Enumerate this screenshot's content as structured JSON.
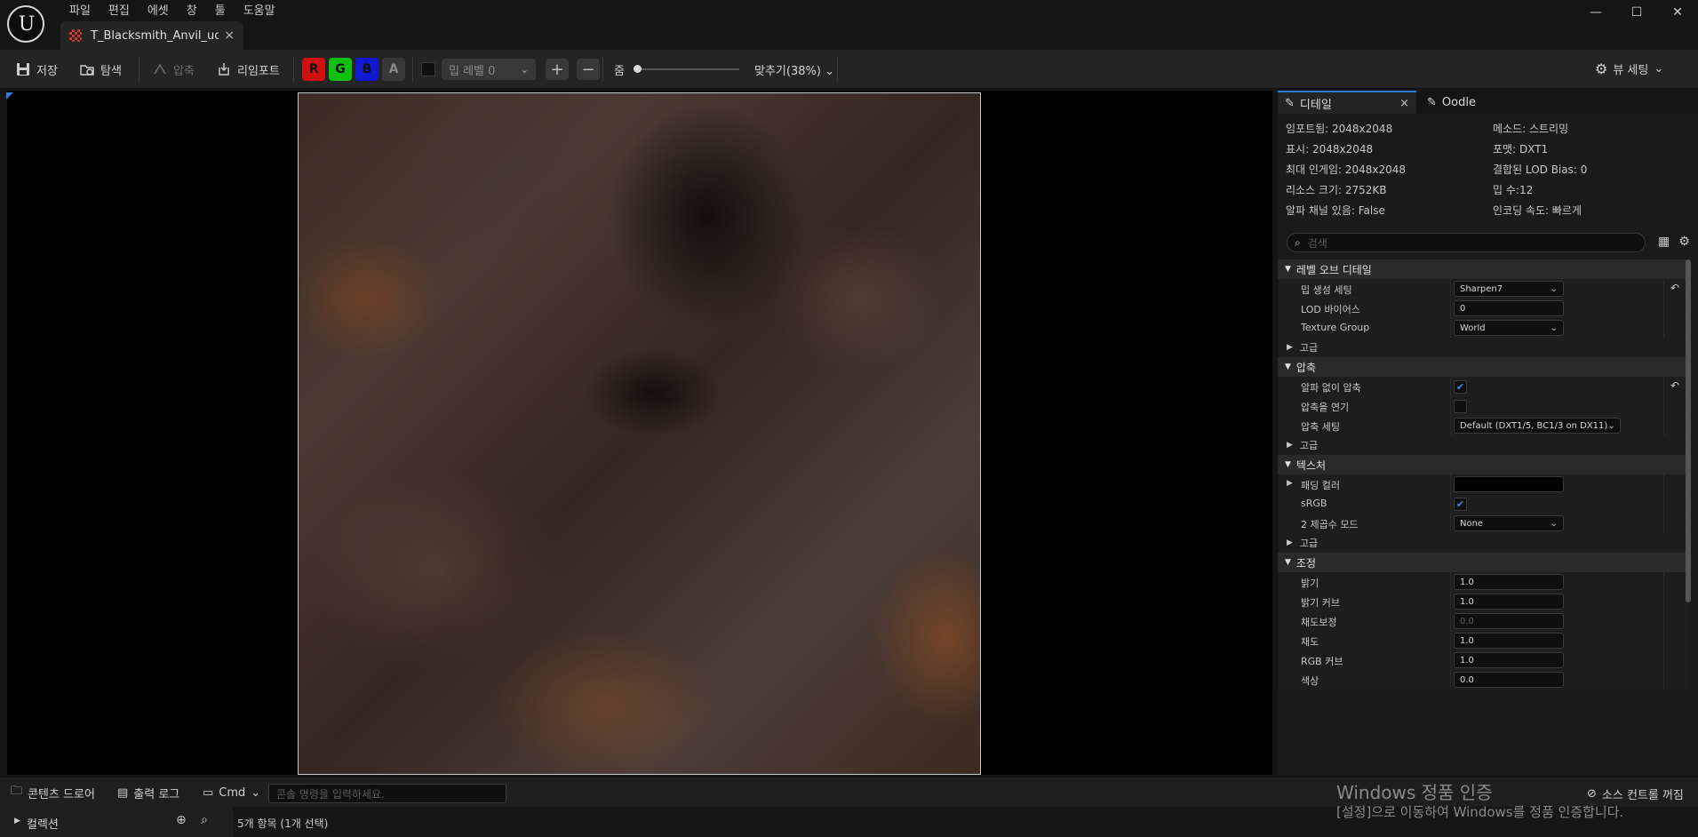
{
  "app": {
    "logo": "ue-logo"
  },
  "menu": [
    "파일",
    "편집",
    "에셋",
    "창",
    "툴",
    "도움말"
  ],
  "window_controls": [
    "—",
    "☐",
    "✕"
  ],
  "document_tab": {
    "label": "T_Blacksmith_Anvil_uck...",
    "close": "×"
  },
  "toolbar": {
    "save": "저장",
    "browse": "탐색",
    "compress": "압축",
    "reimport": "리임포트",
    "channels": [
      "R",
      "G",
      "B",
      "A"
    ],
    "mip_level": "밉 레벨 0",
    "zoom_label": "줌",
    "zoom_fit": "맞추기(38%)",
    "view_settings": "뷰 세팅"
  },
  "details_panel": {
    "tab_details": "디테일",
    "tab_oodle": "Oodle",
    "info": {
      "imported": "임포트됨: 2048x2048",
      "method": "메소드: 스트리밍",
      "displayed": "표시: 2048x2048",
      "format": "포맷: DXT1",
      "max_ingame": "최대 인게임: 2048x2048",
      "combined_lod": "결합된 LOD Bias: 0",
      "resource_size": "리소스 크기: 2752KB",
      "mip_count": "밉 수:12",
      "alpha": "알파 채널 있음: False",
      "encode_speed": "인코딩 속도: 빠르게"
    },
    "search_placeholder": "검색",
    "categories": {
      "lod": "레벨 오브 디테일",
      "compression": "압축",
      "texture": "텍스처",
      "adjustments": "조정"
    },
    "advanced": "고급",
    "props": {
      "mip_gen_label": "밉 생성 세팅",
      "mip_gen_value": "Sharpen7",
      "lod_bias_label": "LOD 바이어스",
      "lod_bias_value": "0",
      "texture_group_label": "Texture Group",
      "texture_group_value": "World",
      "compress_no_alpha_label": "알파 없이 압축",
      "defer_compression_label": "압축을 연기",
      "compression_settings_label": "압축 세팅",
      "compression_settings_value": "Default (DXT1/5, BC1/3 on DX11)",
      "padding_color_label": "패딩 컬러",
      "srgb_label": "sRGB",
      "power_of_two_label": "2 제곱수 모드",
      "power_of_two_value": "None",
      "brightness_label": "밝기",
      "brightness_value": "1.0",
      "brightness_curve_label": "밝기 커브",
      "brightness_curve_value": "1.0",
      "vibrance_label": "채도보정",
      "vibrance_value": "0.0",
      "saturation_label": "채도",
      "saturation_value": "1.0",
      "rgb_curve_label": "RGB 커브",
      "rgb_curve_value": "1.0",
      "hue_label": "색상",
      "hue_value": "0.0"
    },
    "checked": {
      "compress_no_alpha": true,
      "defer_compression": false,
      "srgb": true
    }
  },
  "bottom": {
    "content_drawer": "콘텐츠 드로어",
    "output_log": "출력 로그",
    "cmd": "Cmd",
    "console_placeholder": "콘솔 명령을 입력하세요.",
    "source_control": "소스 컨트롤 꺼짐",
    "collections": "컬렉션",
    "items": "5개 항목 (1개 선택)"
  },
  "watermark": {
    "line1": "Windows 정품 인증",
    "line2": "[설정]으로 이동하여 Windows를 정품 인증합니다."
  },
  "colors": {
    "accent": "#2e7ad0",
    "channel_r": "#d01010",
    "channel_g": "#10c010",
    "channel_b": "#1018d0"
  }
}
